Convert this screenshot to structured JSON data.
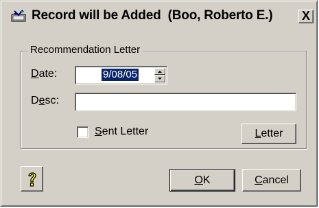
{
  "window": {
    "title": "Record will be Added  (Boo, Roberto E.)",
    "close_label": "X"
  },
  "group": {
    "legend": "Recommendation Letter"
  },
  "date": {
    "label_access": "D",
    "label_rest": "ate:",
    "value": "9/08/05"
  },
  "desc": {
    "label_pre": "D",
    "label_access": "e",
    "label_rest": "sc:",
    "value": ""
  },
  "sent_letter": {
    "label_access": "S",
    "label_rest": "ent Letter",
    "checked": false
  },
  "buttons": {
    "letter_access": "L",
    "letter_rest": "etter",
    "ok_access": "O",
    "ok_rest": "K",
    "cancel_access": "C",
    "cancel_rest": "ancel"
  },
  "icons": {
    "title": "record-add-icon",
    "help": "help-question-icon"
  },
  "colors": {
    "face": "#d4d0c8",
    "selection": "#0a246a",
    "help_yellow": "#ffff00"
  }
}
